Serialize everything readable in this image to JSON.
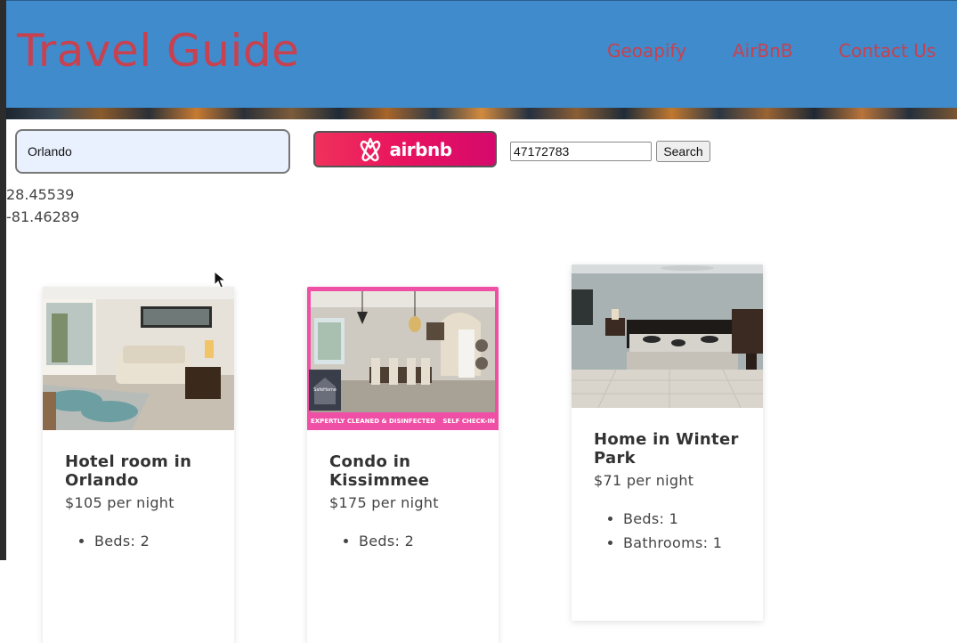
{
  "header": {
    "brand": "Travel Guide",
    "nav": [
      "Geoapify",
      "AirBnB",
      "Contact Us"
    ]
  },
  "search": {
    "city_value": "Orlando",
    "airbnb_label": "airbnb",
    "listing_id_value": "47172783",
    "search_label": "Search"
  },
  "coords": {
    "lat": "28.45539",
    "lon": "-81.46289"
  },
  "listings": [
    {
      "title": "Hotel room in Orlando",
      "price": "$105 per night",
      "amenities": [
        "Beds: 2"
      ]
    },
    {
      "title": "Condo in Kissimmee",
      "price": "$175 per night",
      "amenities": [
        "Beds: 2"
      ],
      "banner_left": "EXPERTLY CLEANED & DISINFECTED",
      "banner_right": "SELF CHECK-IN",
      "badge": "SafeHome"
    },
    {
      "title": "Home in Winter Park",
      "price": "$71 per night",
      "amenities": [
        "Beds: 1",
        "Bathrooms: 1"
      ]
    }
  ],
  "colors": {
    "header_bg": "#3f8bcc",
    "brand_text": "#c8414f",
    "airbnb_pink": "#e8125f",
    "input_bg": "#e9f0fe"
  }
}
